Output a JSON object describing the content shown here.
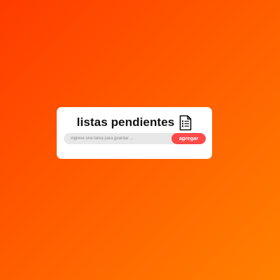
{
  "app": {
    "title": "listas pendientes",
    "title_icon": "document-list-icon"
  },
  "form": {
    "input_value": "",
    "input_placeholder": "ingrese una tarea para guardar ...",
    "add_button_label": "agregar"
  },
  "colors": {
    "background_gradient_start": "#ff3b00",
    "background_gradient_end": "#ff8000",
    "card_background": "#ffffff",
    "input_background": "#e8e8e8",
    "add_button_background": "#ff4a4a",
    "add_button_text": "#ffffff"
  }
}
